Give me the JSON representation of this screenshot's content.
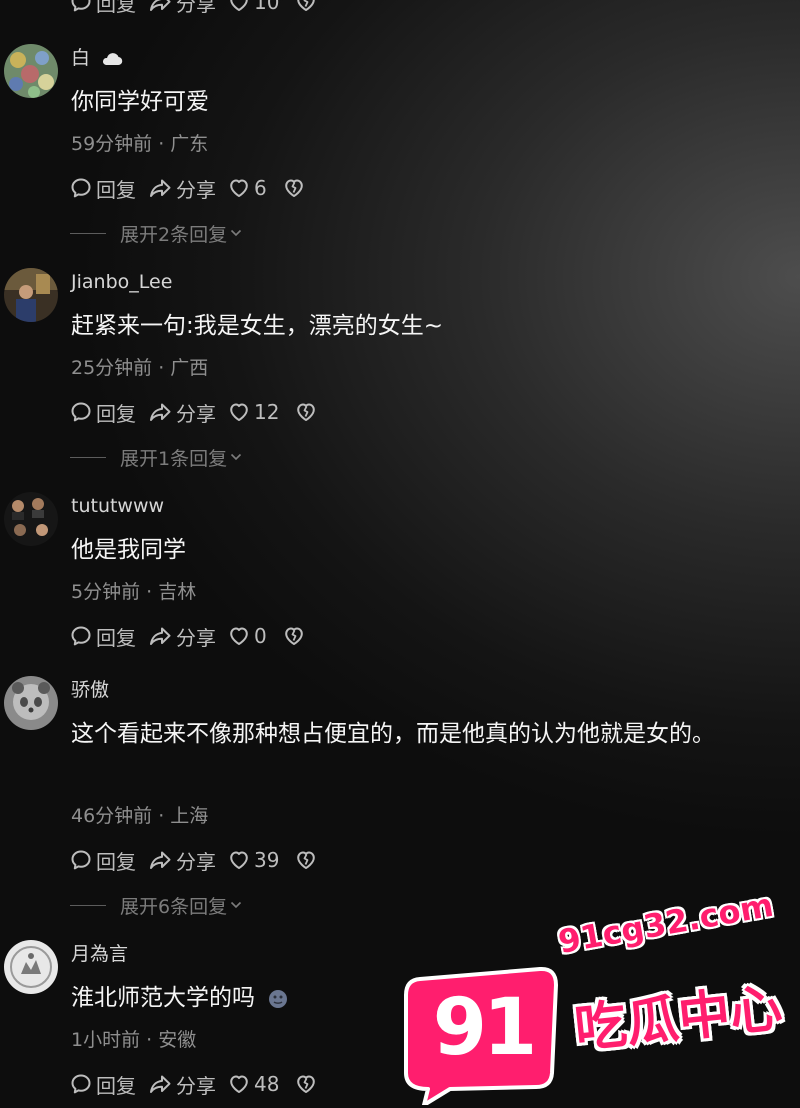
{
  "top_actions": {
    "reply": "回复",
    "share": "分享",
    "likes": "10"
  },
  "comments": [
    {
      "username": "白",
      "text": "你同学好可爱",
      "meta": "59分钟前 · 广东",
      "reply": "回复",
      "share": "分享",
      "likes": "6",
      "expand": "展开2条回复"
    },
    {
      "username": "Jianbo_Lee",
      "text": "赶紧来一句:我是女生，漂亮的女生~",
      "meta": "25分钟前 · 广西",
      "reply": "回复",
      "share": "分享",
      "likes": "12",
      "expand": "展开1条回复"
    },
    {
      "username": "tututwww",
      "text": "他是我同学",
      "meta": "5分钟前 · 吉林",
      "reply": "回复",
      "share": "分享",
      "likes": "0"
    },
    {
      "username": "骄傲",
      "text": "这个看起来不像那种想占便宜的，而是他真的认为他就是女的。",
      "meta": "46分钟前 · 上海",
      "reply": "回复",
      "share": "分享",
      "likes": "39",
      "expand": "展开6条回复"
    },
    {
      "username": "月為言",
      "text": "淮北师范大学的吗",
      "meta": "1小时前 · 安徽",
      "reply": "回复",
      "share": "分享",
      "likes": "48"
    }
  ],
  "watermark": {
    "url": "91cg32.com",
    "number": "91",
    "tagline": "吃瓜中心"
  },
  "colors": {
    "watermark_pink": "#ff1e6e",
    "meta_gray": "#8f8f8f",
    "text_white": "#f5f5f5"
  },
  "icons": [
    "comment-bubble-icon",
    "share-arrow-icon",
    "heart-icon",
    "broken-heart-icon",
    "chevron-down-icon",
    "cloud-icon",
    "emoji-face-icon"
  ]
}
